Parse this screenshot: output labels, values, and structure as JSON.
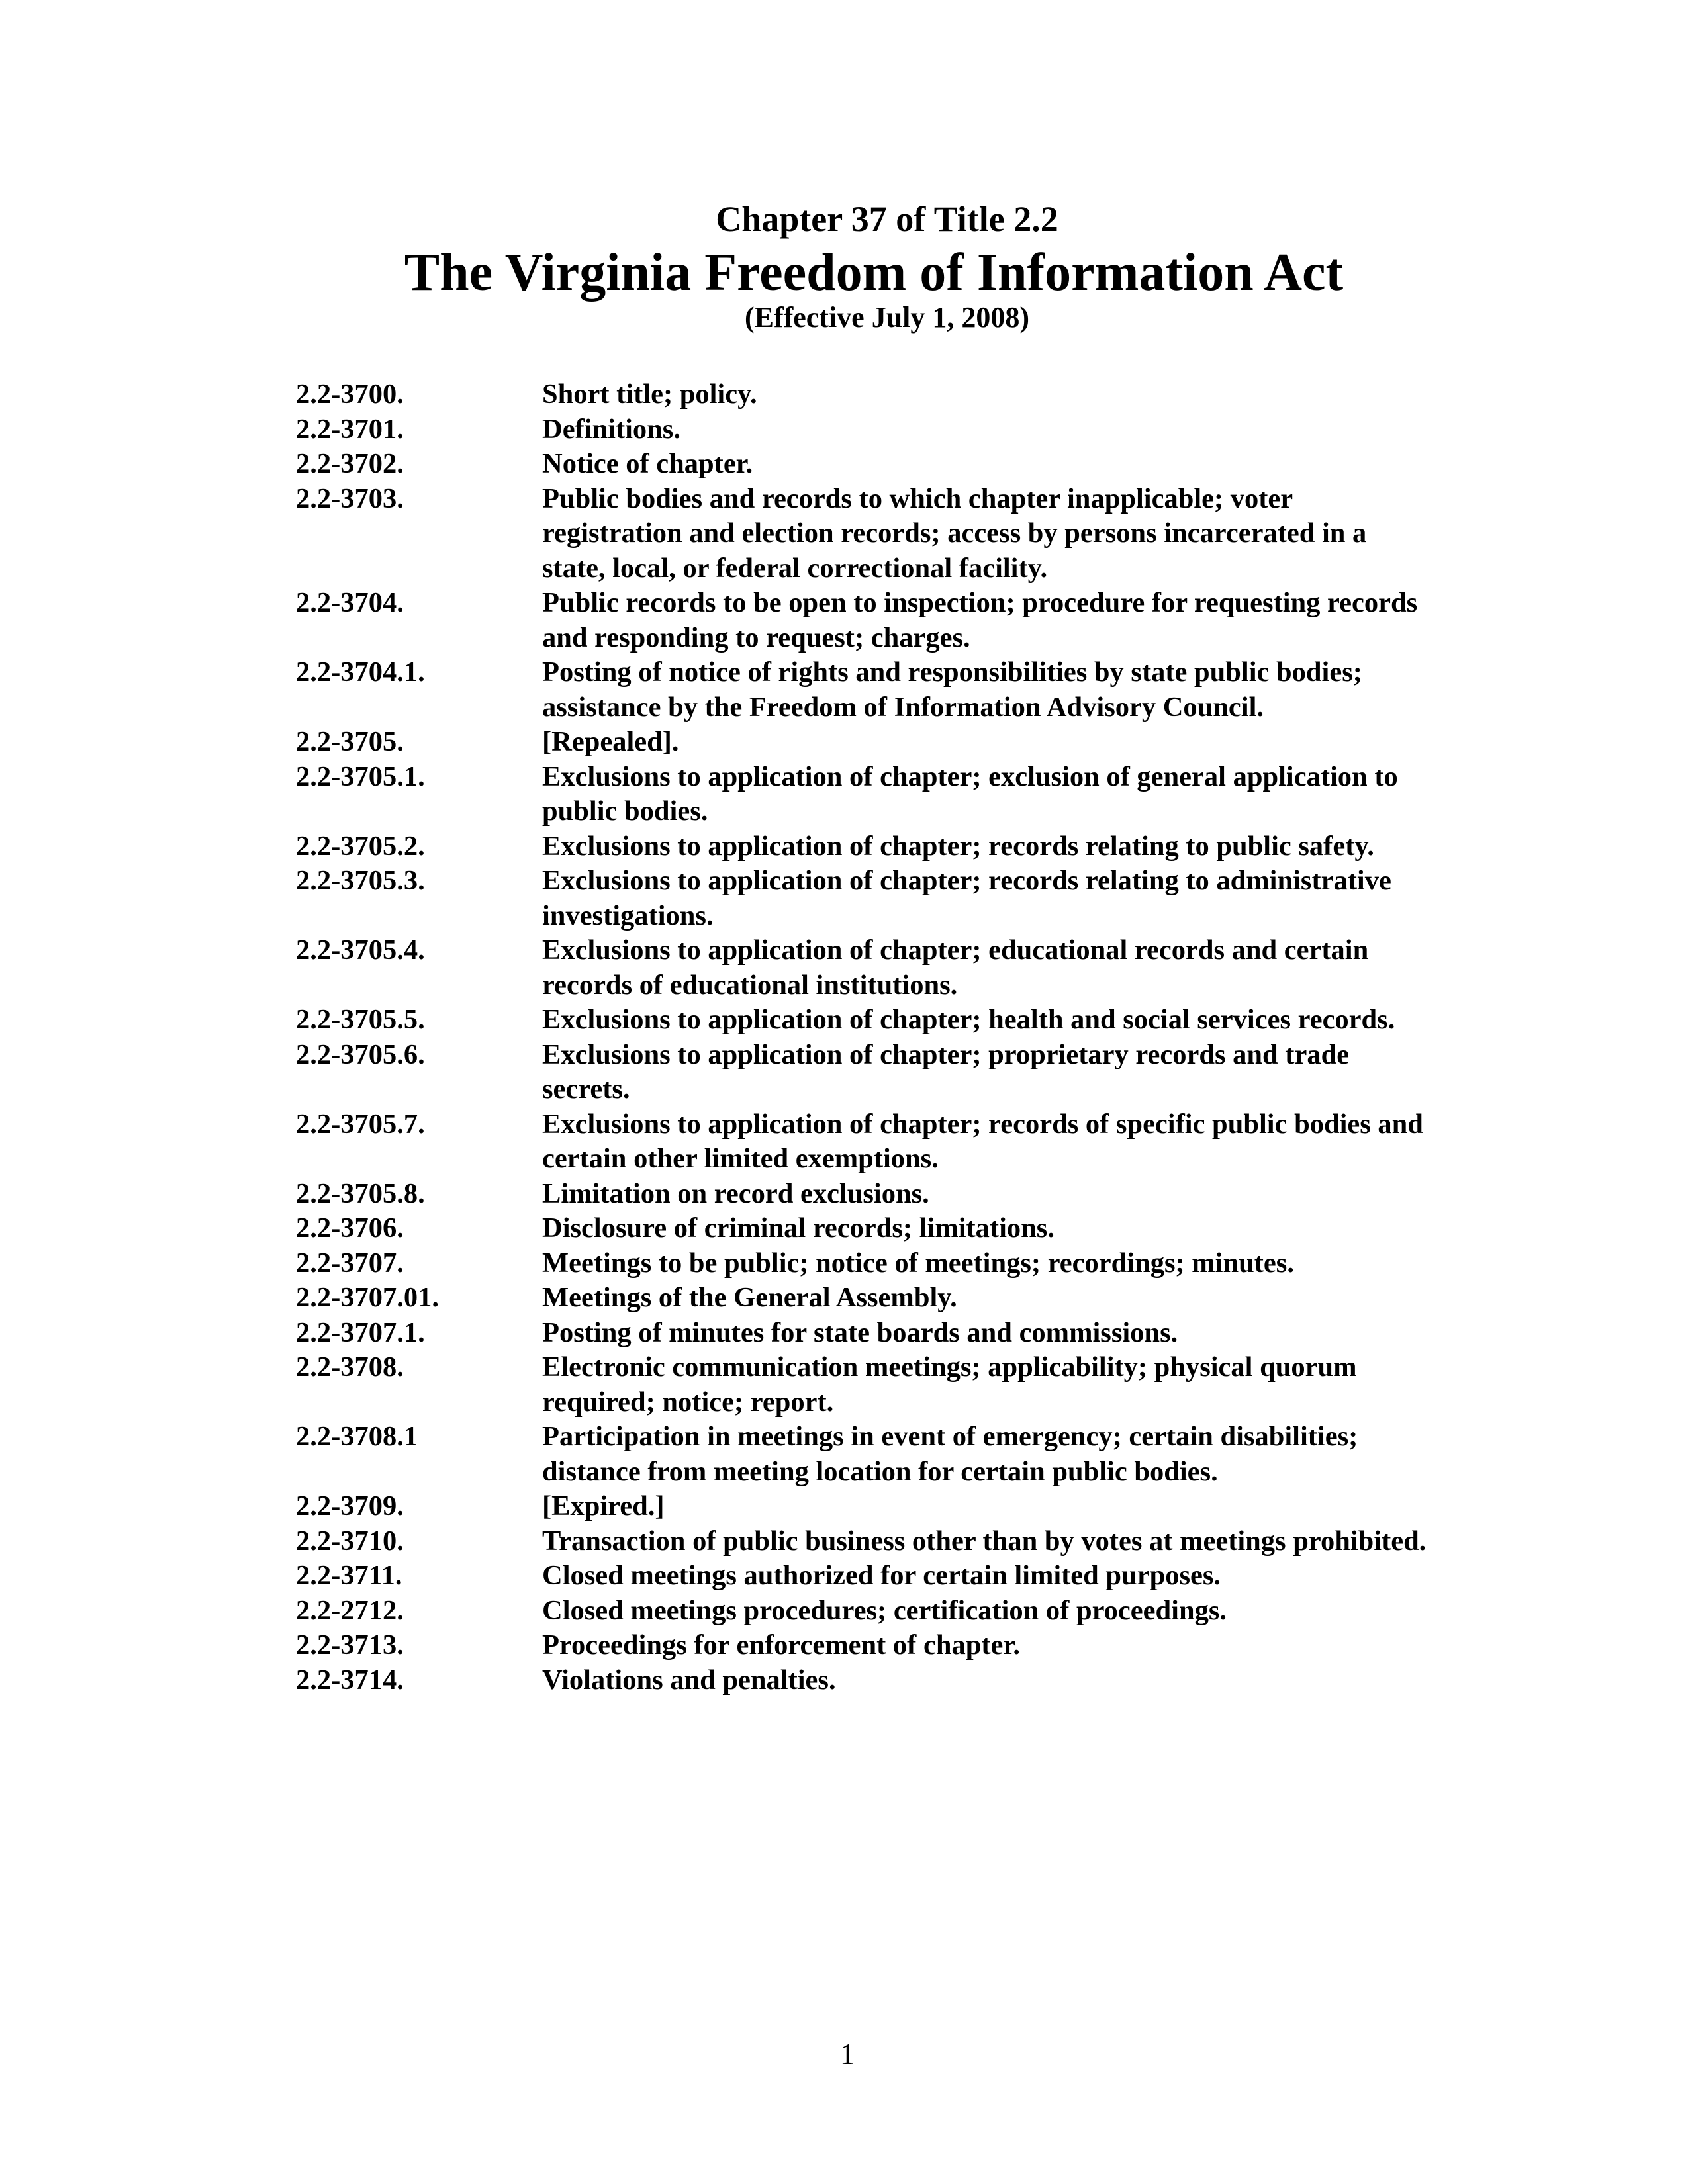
{
  "header": {
    "chapter": "Chapter 37 of Title 2.2",
    "title": "The Virginia Freedom of Information Act",
    "effective": "(Effective July 1, 2008)"
  },
  "toc": [
    {
      "number": "2.2-3700.",
      "text": "Short title; policy."
    },
    {
      "number": "2.2-3701.",
      "text": "Definitions."
    },
    {
      "number": "2.2-3702.",
      "text": "Notice of chapter."
    },
    {
      "number": "2.2-3703.",
      "text": "Public bodies and records to which chapter inapplicable; voter registration and election records; access by persons incarcerated in a state, local, or federal correctional facility."
    },
    {
      "number": "2.2-3704.",
      "text": "Public records to be open to inspection; procedure for requesting records and responding to request; charges."
    },
    {
      "number": "2.2-3704.1.",
      "text": "Posting of notice of rights and responsibilities by state public bodies; assistance by the Freedom of Information Advisory Council."
    },
    {
      "number": "2.2-3705.",
      "text": "[Repealed]."
    },
    {
      "number": "2.2-3705.1.",
      "text": "Exclusions to application of chapter; exclusion of general application to public bodies."
    },
    {
      "number": "2.2-3705.2.",
      "text": "Exclusions to application of chapter; records relating to public safety."
    },
    {
      "number": "2.2-3705.3.",
      "text": "Exclusions to application of chapter; records relating to administrative investigations."
    },
    {
      "number": "2.2-3705.4.",
      "text": "Exclusions to application of chapter; educational records and certain records of educational institutions."
    },
    {
      "number": "2.2-3705.5.",
      "text": "Exclusions to application of chapter; health and social services records."
    },
    {
      "number": "2.2-3705.6.",
      "text": "Exclusions to application of chapter; proprietary records and trade secrets."
    },
    {
      "number": "2.2-3705.7.",
      "text": "Exclusions to application of chapter; records of specific public bodies and certain other limited exemptions."
    },
    {
      "number": "2.2-3705.8.",
      "text": "Limitation on record exclusions."
    },
    {
      "number": "2.2-3706.",
      "text": "Disclosure of criminal records; limitations."
    },
    {
      "number": "2.2-3707.",
      "text": "Meetings to be public; notice of meetings; recordings; minutes."
    },
    {
      "number": "2.2-3707.01.",
      "text": "Meetings of the General Assembly."
    },
    {
      "number": "2.2-3707.1.",
      "text": "Posting of minutes for state boards and commissions."
    },
    {
      "number": "2.2-3708.",
      "text": "Electronic communication meetings; applicability; physical quorum required; notice; report."
    },
    {
      "number": "2.2-3708.1",
      "text": "Participation in meetings in event of emergency; certain disabilities; distance from meeting location for certain public bodies."
    },
    {
      "number": "2.2-3709.",
      "text": "[Expired.]"
    },
    {
      "number": "2.2-3710.",
      "text": "Transaction of public business other than by votes at meetings prohibited."
    },
    {
      "number": "2.2-3711.",
      "text": "Closed meetings authorized for certain limited purposes."
    },
    {
      "number": "2.2-2712.",
      "text": "Closed meetings procedures; certification of proceedings."
    },
    {
      "number": "2.2-3713.",
      "text": "Proceedings for enforcement of chapter."
    },
    {
      "number": "2.2-3714.",
      "text": "Violations and penalties."
    }
  ],
  "footer": {
    "page_number": "1"
  }
}
